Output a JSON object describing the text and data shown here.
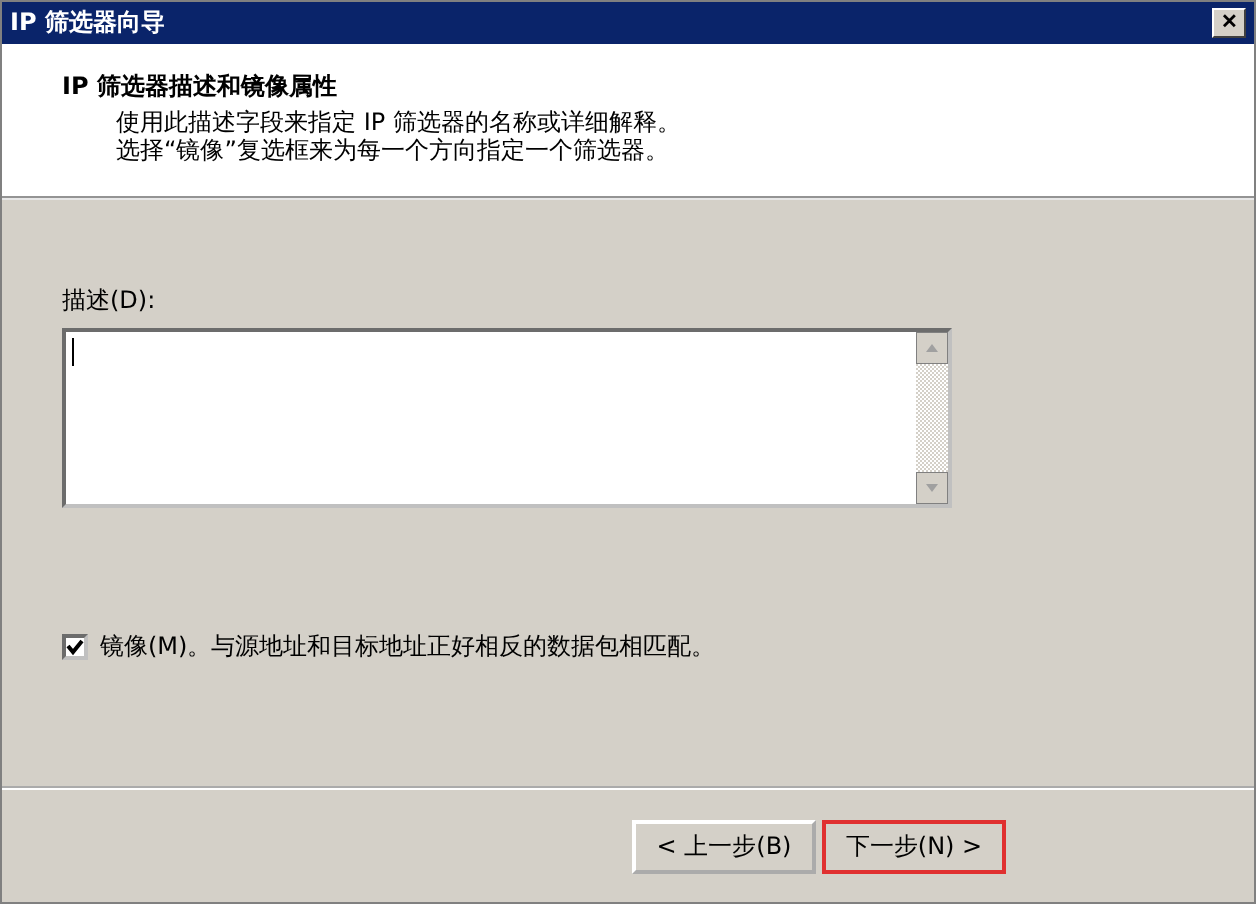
{
  "window": {
    "title": "IP 筛选器向导",
    "close_glyph": "✕"
  },
  "header": {
    "title": "IP 筛选器描述和镜像属性",
    "lines": [
      "使用此描述字段来指定 IP 筛选器的名称或详细解释。",
      "选择“镜像”复选框来为每一个方向指定一个筛选器。"
    ]
  },
  "description": {
    "label": "描述(D):"
  },
  "mirror": {
    "label": "镜像(M)。与源地址和目标地址正好相反的数据包相匹配。",
    "checked": true
  },
  "buttons": [
    {
      "label": "< 上一步(B)",
      "highlighted": false
    },
    {
      "label": "下一步(N) >",
      "highlighted": true
    }
  ]
}
